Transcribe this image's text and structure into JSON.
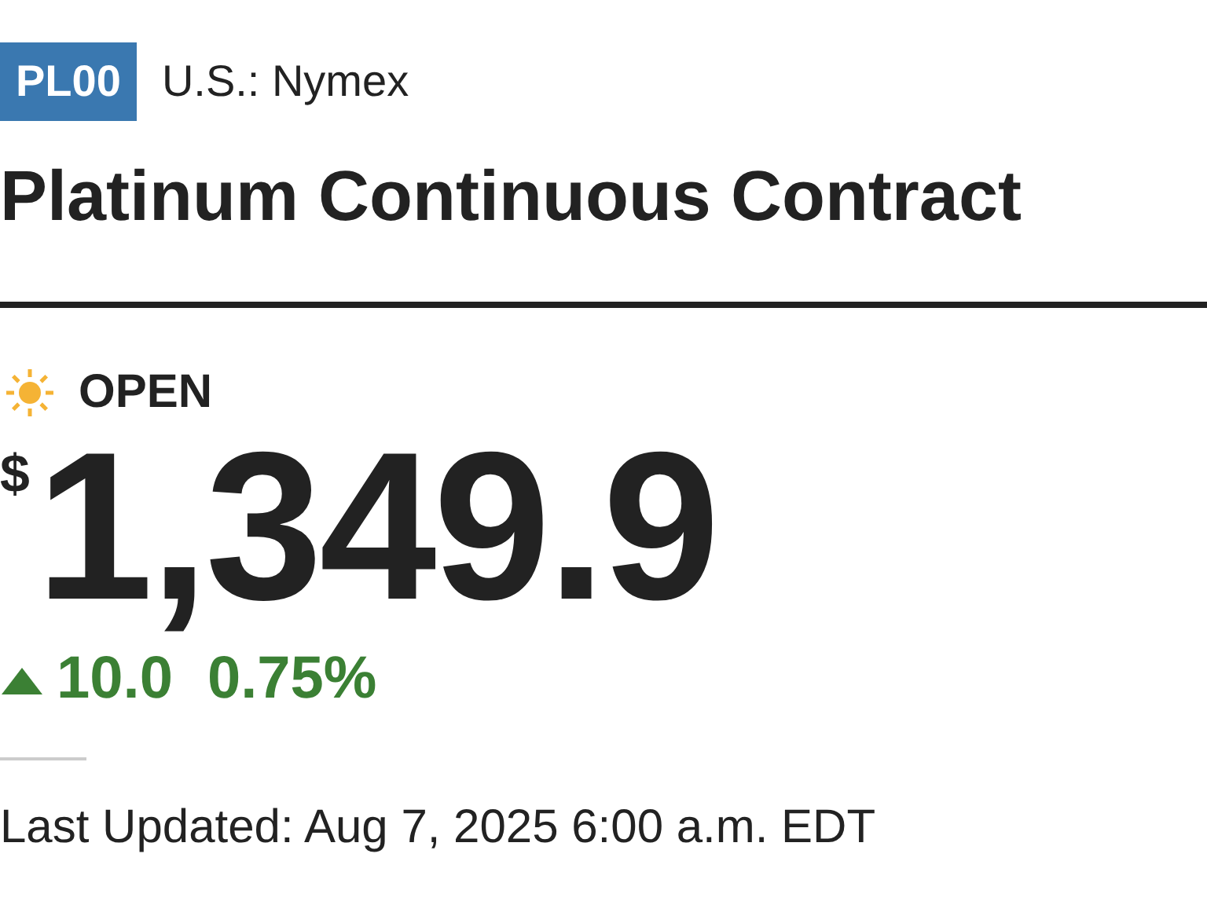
{
  "symbol": "PL00",
  "exchange": "U.S.: Nymex",
  "title": "Platinum Continuous Contract",
  "market_status": {
    "label": "OPEN",
    "open": true
  },
  "price": {
    "currency": "$",
    "value": "1,349.9"
  },
  "change": {
    "rising": true,
    "points": "10.0",
    "percent": "0.75%"
  },
  "last_updated": "Last Updated: Aug 7, 2025 6:00 a.m. EDT"
}
